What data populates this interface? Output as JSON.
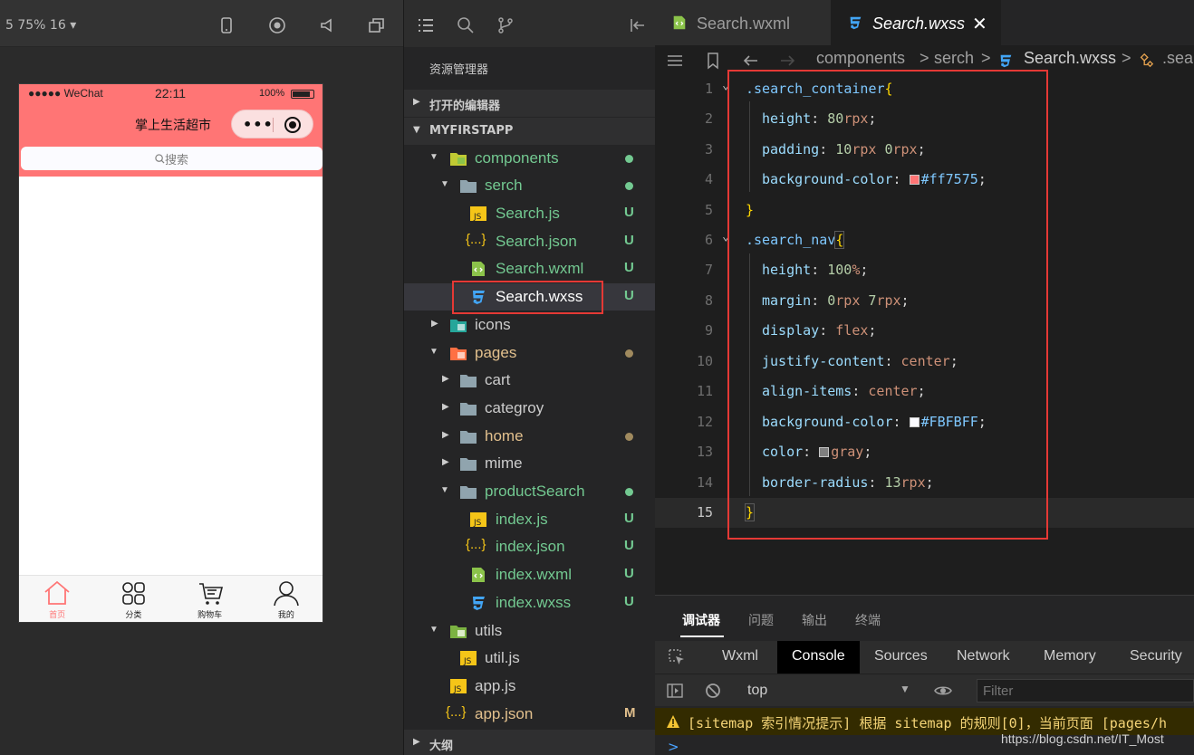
{
  "simulator": {
    "zoom_label": "5 75% 16 ▾",
    "status": {
      "carrier": "●●●●● WeChat",
      "time": "22:11",
      "battery": "100%"
    },
    "nav_title": "掌上生活超市",
    "capsule_dots": "•••",
    "search_placeholder": "搜索",
    "tabbar": [
      {
        "label": "首页",
        "icon": "home-icon"
      },
      {
        "label": "分类",
        "icon": "grid-icon"
      },
      {
        "label": "购物车",
        "icon": "cart-icon"
      },
      {
        "label": "我的",
        "icon": "user-icon"
      }
    ]
  },
  "explorer": {
    "title": "资源管理器",
    "open_editors": "打开的编辑器",
    "project": "MYFIRSTAPP",
    "outline": "大纲",
    "tree": [
      {
        "name": "components",
        "badge": "",
        "dot": true
      },
      {
        "name": "serch",
        "badge": "",
        "dot": true
      },
      {
        "name": "Search.js",
        "badge": "U"
      },
      {
        "name": "Search.json",
        "badge": "U"
      },
      {
        "name": "Search.wxml",
        "badge": "U"
      },
      {
        "name": "Search.wxss",
        "badge": "U"
      },
      {
        "name": "icons",
        "badge": ""
      },
      {
        "name": "pages",
        "badge": "",
        "dot": true
      },
      {
        "name": "cart",
        "badge": ""
      },
      {
        "name": "categroy",
        "badge": ""
      },
      {
        "name": "home",
        "badge": "",
        "dot": true
      },
      {
        "name": "mime",
        "badge": ""
      },
      {
        "name": "productSearch",
        "badge": "",
        "dot": true
      },
      {
        "name": "index.js",
        "badge": "U"
      },
      {
        "name": "index.json",
        "badge": "U"
      },
      {
        "name": "index.wxml",
        "badge": "U"
      },
      {
        "name": "index.wxss",
        "badge": "U"
      },
      {
        "name": "utils",
        "badge": "",
        "dot": true
      },
      {
        "name": "util.js",
        "badge": ""
      },
      {
        "name": "app.js",
        "badge": ""
      },
      {
        "name": "app.json",
        "badge": "M"
      }
    ]
  },
  "editor": {
    "tabs": [
      {
        "label": "Search.wxml"
      },
      {
        "label": "Search.wxss",
        "close": "✕"
      }
    ],
    "breadcrumb": [
      "components",
      ">",
      "serch",
      ">",
      "Search.wxss",
      ">",
      ".sea"
    ],
    "lines": [
      {
        "n": "1",
        "sel": ".search_container",
        "brace": "{"
      },
      {
        "n": "2",
        "prop": "height",
        "val_num": "80",
        "val_unit": "rpx"
      },
      {
        "n": "3",
        "prop": "padding",
        "val_num": "10",
        "val_unit": "rpx",
        "val_num2": "0",
        "val_unit2": "rpx"
      },
      {
        "n": "4",
        "prop": "background-color",
        "swatch": "#ff7575",
        "val_text": "#ff7575"
      },
      {
        "n": "5",
        "close": "}"
      },
      {
        "n": "6",
        "sel": ".search_nav",
        "brace": "{"
      },
      {
        "n": "7",
        "prop": "height",
        "val_num": "100",
        "val_unit": "%"
      },
      {
        "n": "8",
        "prop": "margin",
        "val_num": "0",
        "val_unit": "rpx",
        "val_num2": "7",
        "val_unit2": "rpx"
      },
      {
        "n": "9",
        "prop": "display",
        "val_kw": "flex"
      },
      {
        "n": "10",
        "prop": "justify-content",
        "val_kw": "center"
      },
      {
        "n": "11",
        "prop": "align-items",
        "val_kw": "center"
      },
      {
        "n": "12",
        "prop": "background-color",
        "swatch": "#FBFBFF",
        "val_text": "#FBFBFF"
      },
      {
        "n": "13",
        "prop": "color",
        "swatch": "gray",
        "val_kw": "gray"
      },
      {
        "n": "14",
        "prop": "border-radius",
        "val_num": "13",
        "val_unit": "rpx"
      },
      {
        "n": "15",
        "close": "}"
      }
    ]
  },
  "devtools": {
    "tabs": [
      "调试器",
      "问题",
      "输出",
      "终端"
    ],
    "panels": [
      "Wxml",
      "Console",
      "Sources",
      "Network",
      "Memory",
      "Security"
    ],
    "context": "top",
    "filter_placeholder": "Filter",
    "warning": "[sitemap 索引情况提示] 根据 sitemap 的规则[0]，当前页面 [pages/h",
    "prompt": ">",
    "watermark": "https://blog.csdn.net/IT_Most"
  },
  "colors": {
    "accent": "#ff7575",
    "selection_box": "#e53935",
    "git_untracked": "#73c991",
    "git_modified": "#e2c08d"
  }
}
